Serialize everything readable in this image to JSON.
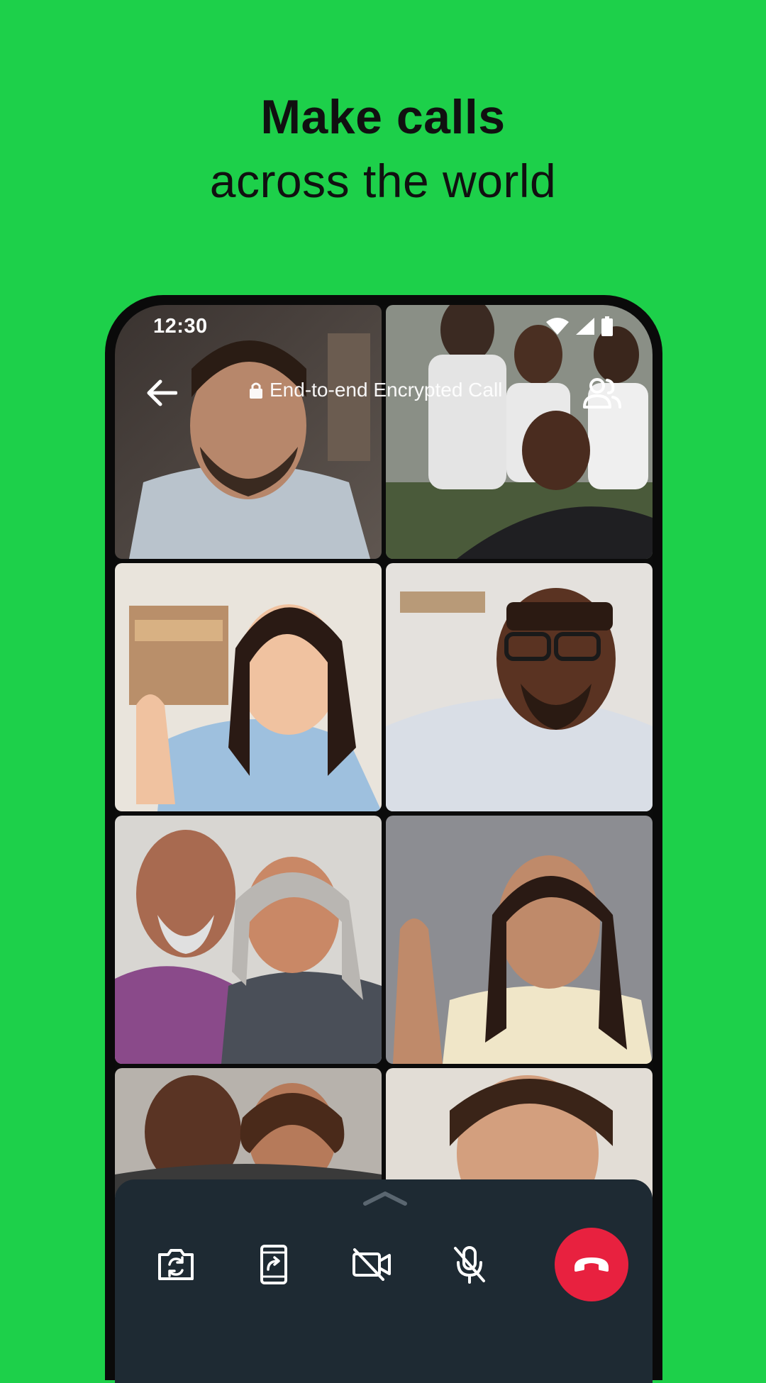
{
  "headline": {
    "line1": "Make calls",
    "line2": "across the world"
  },
  "status_bar": {
    "time": "12:30",
    "icons": [
      "wifi-icon",
      "cell-signal-icon",
      "battery-icon"
    ]
  },
  "call_header": {
    "back_icon": "arrow-left-icon",
    "lock_icon": "lock-icon",
    "encrypted_label": "End-to-end Encrypted Call",
    "participants_icon": "people-icon"
  },
  "participants": [
    {
      "name": "participant-1",
      "description": "man with beard in light shirt"
    },
    {
      "name": "participant-2",
      "description": "group of friends outdoors"
    },
    {
      "name": "participant-3",
      "description": "woman waving in denim shirt"
    },
    {
      "name": "participant-4",
      "description": "man with glasses smiling"
    },
    {
      "name": "participant-5",
      "description": "older couple"
    },
    {
      "name": "participant-6",
      "description": "woman waving"
    },
    {
      "name": "participant-7",
      "description": "couple smiling"
    },
    {
      "name": "participant-8",
      "description": "woman smiling"
    }
  ],
  "controls": {
    "buttons": [
      {
        "icon": "flip-camera-icon"
      },
      {
        "icon": "screen-share-icon"
      },
      {
        "icon": "video-off-icon"
      },
      {
        "icon": "mic-off-icon"
      },
      {
        "icon": "end-call-icon"
      }
    ],
    "colors": {
      "panel": "#1E2A33",
      "end_call": "#E8213F",
      "background": "#1DD04A"
    }
  }
}
